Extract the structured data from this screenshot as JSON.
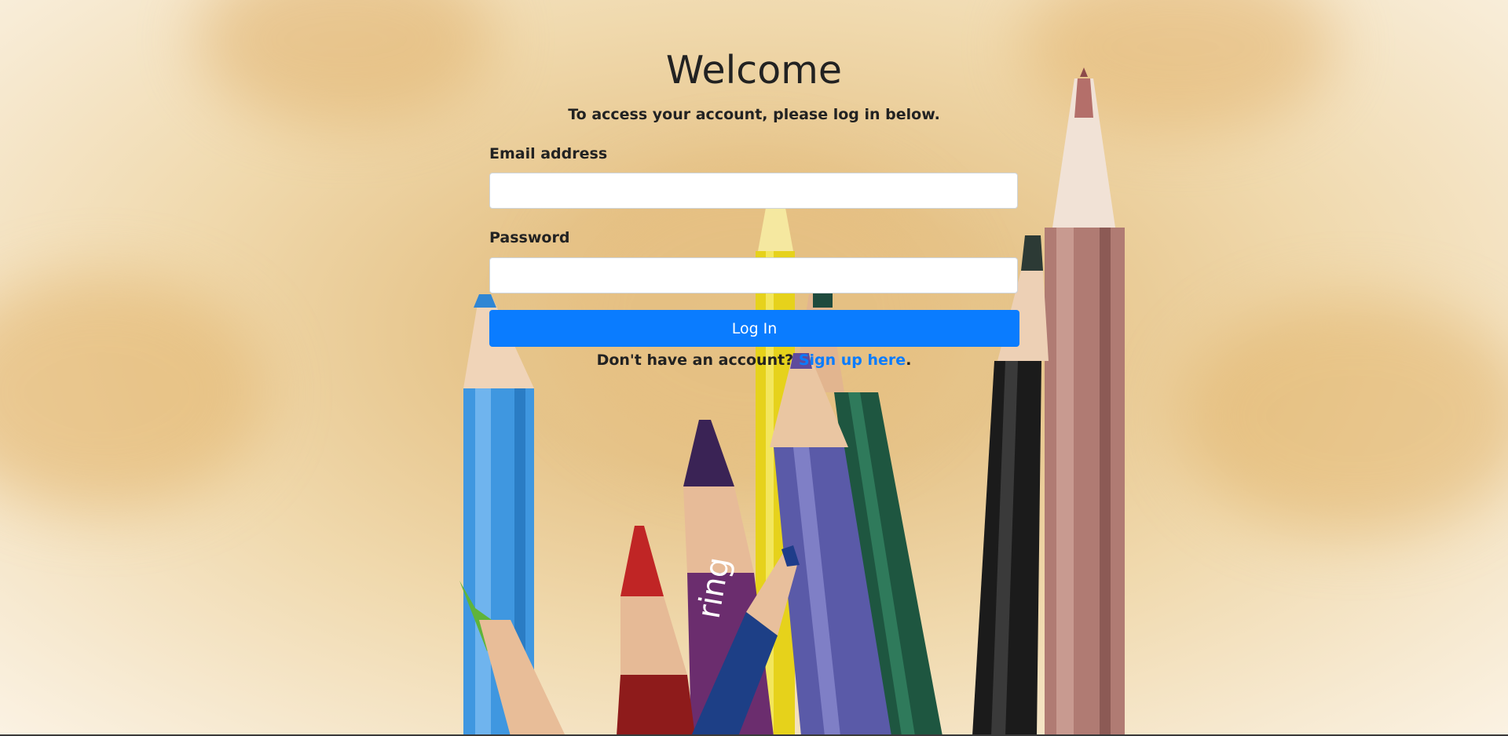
{
  "page": {
    "title": "Welcome",
    "subtitle": "To access your account, please log in below."
  },
  "form": {
    "email_label": "Email address",
    "email_value": "",
    "password_label": "Password",
    "password_value": "",
    "login_label": "Log In"
  },
  "signup": {
    "prompt": "Don't have an account?",
    "link_label": "Sign up here",
    "suffix": "."
  },
  "colors": {
    "accent": "#0a7cff",
    "text": "#222222",
    "background": "#e8c68c"
  }
}
